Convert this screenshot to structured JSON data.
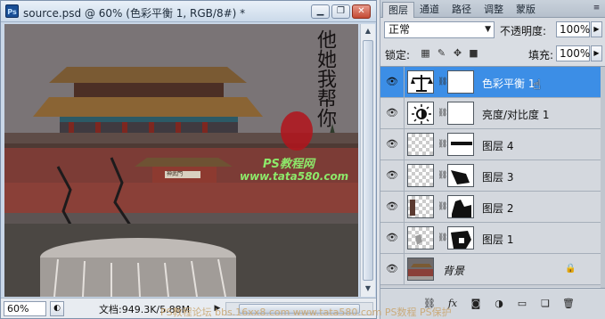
{
  "document": {
    "title": "source.psd @ 60% (色彩平衡 1, RGB/8#) *",
    "app_icon": "Ps",
    "window_buttons": {
      "minimize": "▁",
      "restore": "❐",
      "close": "✕"
    },
    "zoom": "60%",
    "doc_info": "文档:949.3K/5.88M",
    "canvas": {
      "calligraphy": "他她我帮你",
      "site_label_cn": "PS教程网",
      "site_label_url": "www.tata580.com",
      "gate_plaque": "神武門"
    }
  },
  "layers_panel": {
    "tabs": [
      "图层",
      "通道",
      "路径",
      "调整",
      "蒙版"
    ],
    "active_tab_index": 0,
    "panel_menu_icon": "≡",
    "blend_mode": "正常",
    "opacity_label": "不透明度:",
    "opacity_value": "100%",
    "lock_label": "锁定:",
    "lock_icons": [
      "lock-transparent-icon",
      "lock-pixels-icon",
      "lock-position-icon",
      "lock-all-icon"
    ],
    "fill_label": "填充:",
    "fill_value": "100%",
    "layers": [
      {
        "name": "色彩平衡 1",
        "visible": true,
        "selected": true,
        "kind": "adjustment-color-balance"
      },
      {
        "name": "亮度/对比度 1",
        "visible": true,
        "selected": false,
        "kind": "adjustment-brightness"
      },
      {
        "name": "图层 4",
        "visible": true,
        "selected": false,
        "kind": "pixel"
      },
      {
        "name": "图层 3",
        "visible": true,
        "selected": false,
        "kind": "pixel"
      },
      {
        "name": "图层 2",
        "visible": true,
        "selected": false,
        "kind": "pixel"
      },
      {
        "name": "图层 1",
        "visible": true,
        "selected": false,
        "kind": "pixel"
      },
      {
        "name": "背景",
        "visible": true,
        "selected": false,
        "kind": "background",
        "locked": true
      }
    ],
    "footer_icons": [
      "link-layers-icon",
      "fx-icon",
      "add-mask-icon",
      "new-adjustment-icon",
      "new-group-icon",
      "new-layer-icon",
      "delete-layer-icon"
    ]
  },
  "watermark_text": "PS教程论坛 bbs.16xx8.com www.tata580.com PS数程 PS保护",
  "colors": {
    "selection": "#3c8ee6",
    "title_bar": "#cbdaea",
    "panel_bg": "#d9dde3"
  }
}
